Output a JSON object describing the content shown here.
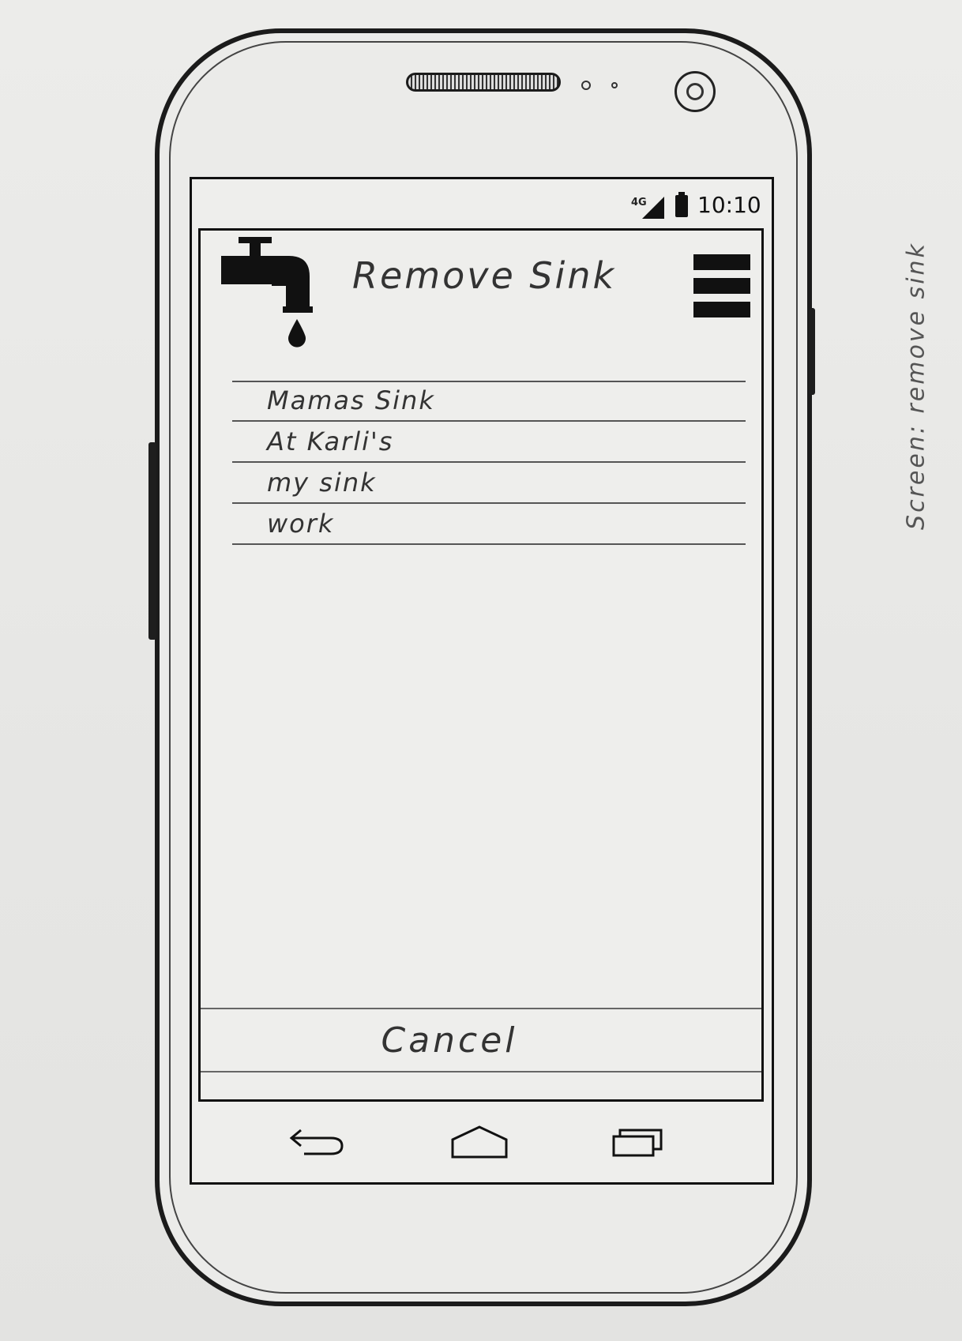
{
  "status_bar": {
    "network": "4G",
    "time": "10:10"
  },
  "app_bar": {
    "logo_icon": "faucet-icon",
    "title": "Remove Sink",
    "menu_icon": "hamburger-menu-icon"
  },
  "sinks": [
    {
      "label": "Mamas Sink"
    },
    {
      "label": "At Karli's"
    },
    {
      "label": "my sink"
    },
    {
      "label": "work"
    }
  ],
  "actions": {
    "cancel_label": "Cancel"
  },
  "nav_bar": {
    "back_icon": "back-arrow-icon",
    "home_icon": "home-icon",
    "recents_icon": "recent-apps-icon"
  },
  "annotation": {
    "text": "Screen: remove sink"
  }
}
